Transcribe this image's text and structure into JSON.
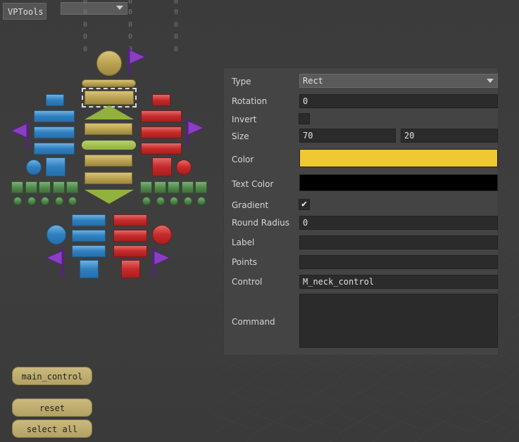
{
  "title_tab": "VPTools",
  "zeros": [
    "0",
    "0",
    "0",
    "0",
    "0",
    "0",
    "0",
    "0",
    "0",
    "0",
    "0",
    "0",
    "0",
    "0",
    "0",
    "0",
    "0",
    "0",
    "0",
    "0",
    "0"
  ],
  "icons": {
    "flag": "flag-icon",
    "dropdown": "chevron-down-icon",
    "check": "checkmark-icon"
  },
  "colors": {
    "accent_gold": "#bca352",
    "blue": "#2f7fbf",
    "red": "#c72a2a",
    "green": "#4f8a4a",
    "purple": "#7a2fb0",
    "lime": "#92b23e",
    "panel_bg": "#444444"
  },
  "panel": {
    "type": {
      "label": "Type",
      "value": "Rect"
    },
    "rotation": {
      "label": "Rotation",
      "value": "0"
    },
    "invert": {
      "label": "Invert",
      "checked": false
    },
    "size": {
      "label": "Size",
      "w": "70",
      "h": "20"
    },
    "color": {
      "label": "Color",
      "value": "#f0c832"
    },
    "text_color": {
      "label": "Text Color",
      "value": "#000000"
    },
    "gradient": {
      "label": "Gradient",
      "checked": true,
      "mark": "✔"
    },
    "round_radius": {
      "label": "Round Radius",
      "value": "0"
    },
    "label_field": {
      "label": "Label",
      "value": ""
    },
    "points": {
      "label": "Points",
      "value": ""
    },
    "control": {
      "label": "Control",
      "value": "M_neck_control"
    },
    "command": {
      "label": "Command",
      "value": ""
    }
  },
  "buttons": {
    "main_control": "main_control",
    "reset": "reset",
    "select_all": "select all"
  }
}
